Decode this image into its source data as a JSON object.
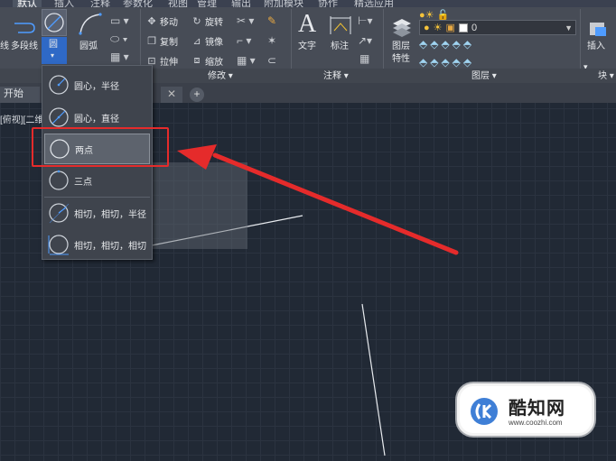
{
  "menu_tabs": [
    "默认",
    "插入",
    "注释",
    "参数化",
    "视图",
    "管理",
    "输出",
    "附加模块",
    "协作",
    "精选应用"
  ],
  "ribbon": {
    "draw": {
      "polyline": "多段线",
      "circle": "圆",
      "arc": "圆弧"
    },
    "modify": {
      "move": "移动",
      "rotate": "旋转",
      "copy": "复制",
      "mirror": "镜像",
      "stretch": "拉伸",
      "scale": "缩放",
      "title": "修改 ▾"
    },
    "annotation": {
      "text": "文字",
      "dimension": "标注",
      "title": "注释 ▾"
    },
    "layers": {
      "properties_line1": "图层",
      "properties_line2": "特性",
      "current_layer": "0",
      "title": "图层 ▾"
    },
    "block": {
      "insert": "插入",
      "title": "块 ▾"
    },
    "left_cut_label": "线"
  },
  "doc_tab": {
    "start": "开始"
  },
  "viewport_label": "[俯视][二维",
  "circle_menu": {
    "items": [
      {
        "label": "圆心，半径"
      },
      {
        "label": "圆心，直径"
      },
      {
        "label": "两点"
      },
      {
        "label": "三点"
      },
      {
        "label": "相切，相切，半径"
      },
      {
        "label": "相切，相切，相切"
      }
    ],
    "selected_index": 2
  },
  "watermark": {
    "name": "酷知网",
    "url": "www.coozhi.com"
  },
  "colors": {
    "annotation_red": "#e52b2b",
    "accent_blue": "#3f7fd6"
  }
}
